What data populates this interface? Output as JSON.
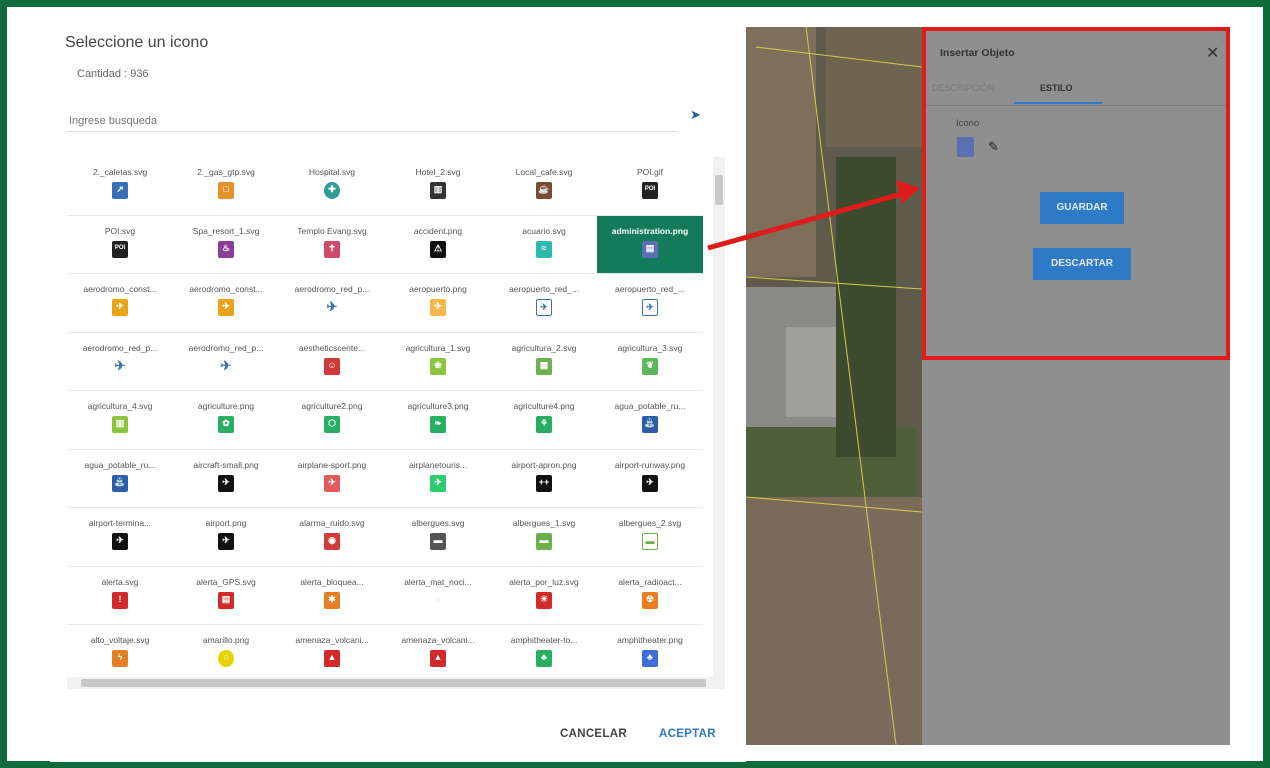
{
  "dialog": {
    "title": "Seleccione un icono",
    "count": "Cantidad : 936",
    "search_placeholder": "Ingrese busqueda",
    "cancel_label": "CANCELAR",
    "accept_label": "ACEPTAR",
    "icons": [
      {
        "label": "2._caletas.svg",
        "color": "#3b6fb5",
        "glyph": "↗"
      },
      {
        "label": "2._gas_gtp.svg",
        "color": "#e3932a",
        "glyph": "□"
      },
      {
        "label": "Hospital.svg",
        "color": "#2e9d94",
        "glyph": "✚",
        "round": true
      },
      {
        "label": "Hotel_2.svg",
        "color": "#333",
        "glyph": "▥"
      },
      {
        "label": "Local_cafe.svg",
        "color": "#7a4a32",
        "glyph": "☕"
      },
      {
        "label": "POI.gif",
        "color": "#222",
        "glyph": "POI"
      },
      {
        "label": "POI.svg",
        "color": "#222",
        "glyph": "POI"
      },
      {
        "label": "Spa_resort_1.svg",
        "color": "#8a3d99",
        "glyph": "♨"
      },
      {
        "label": "Templo Evang.svg",
        "color": "#d04a6a",
        "glyph": "✝"
      },
      {
        "label": "accident.png",
        "color": "#111",
        "glyph": "⚠"
      },
      {
        "label": "acuario.svg",
        "color": "#2db8b0",
        "glyph": "≈"
      },
      {
        "label": "administration.png",
        "color": "#5b6fb3",
        "glyph": "▤",
        "selected": true
      },
      {
        "label": "aerodromo_const...",
        "color": "#e8a317",
        "glyph": "✈"
      },
      {
        "label": "aerodromo_const...",
        "color": "#e8a317",
        "glyph": "✈"
      },
      {
        "label": "aerodromo_red_p...",
        "color": "#3b6fb5",
        "glyph": "✈",
        "plain": true
      },
      {
        "label": "aeropuerto.png",
        "color": "#f5b84a",
        "glyph": "✈"
      },
      {
        "label": "aeropuerto_red_...",
        "color": "#3b6fb5",
        "glyph": "✈",
        "outline": true
      },
      {
        "label": "aeropuerto_red_...",
        "color": "#3b6fb5",
        "glyph": "✈",
        "outline": true
      },
      {
        "label": "aerodromo_red_p...",
        "color": "#3b6fb5",
        "glyph": "✈",
        "plain": true
      },
      {
        "label": "aerodromo_red_p...",
        "color": "#3b6fb5",
        "glyph": "✈",
        "plain": true
      },
      {
        "label": "aestheticscente...",
        "color": "#d03a3a",
        "glyph": "☺"
      },
      {
        "label": "agricultura_1.svg",
        "color": "#8cc63f",
        "glyph": "❀"
      },
      {
        "label": "agricultura_2.svg",
        "color": "#6ab04c",
        "glyph": "▦"
      },
      {
        "label": "agricultura_3.svg",
        "color": "#5cb85c",
        "glyph": "❦"
      },
      {
        "label": "agricultura_4.svg",
        "color": "#8cc63f",
        "glyph": "▥"
      },
      {
        "label": "agriculture.png",
        "color": "#27ae60",
        "glyph": "✿"
      },
      {
        "label": "agriculture2.png",
        "color": "#27ae60",
        "glyph": "⬡"
      },
      {
        "label": "agriculture3.png",
        "color": "#27ae60",
        "glyph": "❧"
      },
      {
        "label": "agriculture4.png",
        "color": "#27ae60",
        "glyph": "⚘"
      },
      {
        "label": "agua_potable_ru...",
        "color": "#2a5fa8",
        "glyph": "⛲"
      },
      {
        "label": "agua_potable_ru...",
        "color": "#2a5fa8",
        "glyph": "⛲"
      },
      {
        "label": "aircraft-small.png",
        "color": "#111",
        "glyph": "✈"
      },
      {
        "label": "airplane-sport.png",
        "color": "#e35b5b",
        "glyph": "✈"
      },
      {
        "label": "airplanetouris...",
        "color": "#2ecc71",
        "glyph": "✈"
      },
      {
        "label": "airport-apron.png",
        "color": "#111",
        "glyph": "++"
      },
      {
        "label": "airport-runway.png",
        "color": "#111",
        "glyph": "✈"
      },
      {
        "label": "airport-termina...",
        "color": "#111",
        "glyph": "✈"
      },
      {
        "label": "airport.png",
        "color": "#111",
        "glyph": "✈"
      },
      {
        "label": "alarma_ruido.svg",
        "color": "#d03a3a",
        "glyph": "◉"
      },
      {
        "label": "albergues.svg",
        "color": "#555",
        "glyph": "▬"
      },
      {
        "label": "albergues_1.svg",
        "color": "#6ab04c",
        "glyph": "▬"
      },
      {
        "label": "albergues_2.svg",
        "color": "#6ab04c",
        "glyph": "▬",
        "outline": true
      },
      {
        "label": "alerta.svg",
        "color": "#d02a2a",
        "glyph": "!"
      },
      {
        "label": "alerta_GPS.svg",
        "color": "#d02a2a",
        "glyph": "▤"
      },
      {
        "label": "alerta_bloquea...",
        "color": "#e67e22",
        "glyph": "✱"
      },
      {
        "label": "alerta_mat_noci...",
        "color": "#cfd8dc",
        "glyph": "▫",
        "plain": true
      },
      {
        "label": "alerta_por_luz.svg",
        "color": "#d02a2a",
        "glyph": "☀"
      },
      {
        "label": "alerta_radioact...",
        "color": "#e67e22",
        "glyph": "☢"
      },
      {
        "label": "alto_voltaje.svg",
        "color": "#e67e22",
        "glyph": "ϟ"
      },
      {
        "label": "amarillo.png",
        "color": "#e5d400",
        "glyph": "○",
        "round": true
      },
      {
        "label": "amenaza_volcani...",
        "color": "#d02a2a",
        "glyph": "▲"
      },
      {
        "label": "amenaza_volcani...",
        "color": "#d02a2a",
        "glyph": "▲"
      },
      {
        "label": "amphitheater-to...",
        "color": "#27ae60",
        "glyph": "♣"
      },
      {
        "label": "amphitheater.png",
        "color": "#3b6fd5",
        "glyph": "♣"
      }
    ]
  },
  "panel": {
    "title": "Insertar Objeto",
    "tab_description": "DESCRIPCIÓN",
    "tab_style": "ESTILO",
    "icon_label": "Icono",
    "save_label": "GUARDAR",
    "discard_label": "DESCARTAR"
  },
  "colors": {
    "frame": "#0f6a3c",
    "highlight": "#e01b1b",
    "accent": "#2a79c8",
    "selected_cell": "#137a5a"
  }
}
